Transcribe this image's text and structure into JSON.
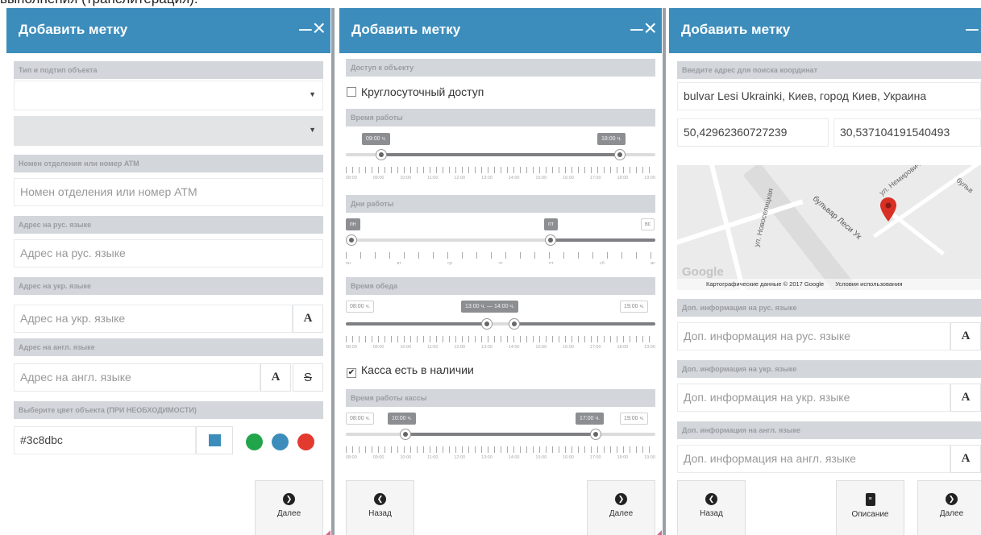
{
  "top_caption": "выполнения (транслитерация).",
  "panels": [
    {
      "title": "Добавить метку",
      "minimize_label": "–",
      "close_label": "×",
      "type_label": "Тип и подтип объекта",
      "type_select_value": "",
      "subtype_select_value": "",
      "branch_label": "Номен отделения или номер ATM",
      "branch_placeholder": "Номен отделения или номер ATM",
      "addr_ru_label": "Адрес на рус. языке",
      "addr_ru_placeholder": "Адрес на рус. языке",
      "addr_uk_label": "Адрес на укр. языке",
      "addr_uk_placeholder": "Адрес на укр. языке",
      "addr_en_label": "Адрес на англ. языке",
      "addr_en_placeholder": "Адрес на англ. языке",
      "translit_button": "A",
      "strike_button": "S",
      "color_label": "Выберите цвет объекта (ПРИ НЕОБХОДИМОСТИ)",
      "color_value": "#3c8dbc",
      "color_options": [
        "#22a54a",
        "#3c8dbc",
        "#e23a2f"
      ],
      "next_label": "Далее"
    },
    {
      "title": "Добавить метку",
      "minimize_label": "–",
      "close_label": "×",
      "access_label": "Доступ к объекту",
      "access_checkbox": "Круглосуточный доступ",
      "access_checked": false,
      "work_time_label": "Время работы",
      "work_start": "09:00 ч.",
      "work_end": "18:00 ч.",
      "work_start_fraction": 0.1,
      "work_end_fraction": 0.9,
      "hours_ticks": [
        "08:00",
        "09:00",
        "10:00",
        "11:00",
        "12:00",
        "13:00",
        "14:00",
        "15:00",
        "16:00",
        "17:00",
        "18:00",
        "19:00"
      ],
      "days_label": "Дни работы",
      "days_start": "пн",
      "days_end": "пт",
      "days_max": "вс",
      "days_ticks": [
        "пн",
        "вт",
        "ср",
        "чт",
        "пт",
        "сб",
        "вс"
      ],
      "days_start_fraction": 0.0,
      "days_end_fraction": 0.667,
      "lunch_label": "Время обеда",
      "lunch_min": "08:00 ч.",
      "lunch_range": "13:00 ч. — 14:00 ч.",
      "lunch_max": "19:00 ч.",
      "lunch_start_fraction": 0.455,
      "lunch_end_fraction": 0.545,
      "cashier_checkbox": "Касса есть в наличии",
      "cashier_checked": true,
      "cashier_time_label": "Время работы кассы",
      "cashier_min": "08:00 ч.",
      "cashier_start": "10:00 ч.",
      "cashier_end": "17:00 ч.",
      "cashier_max": "19:00 ч.",
      "cashier_start_fraction": 0.182,
      "cashier_end_fraction": 0.818,
      "back_label": "Назад",
      "next_label": "Далее"
    },
    {
      "title": "Добавить метку",
      "minimize_label": "–",
      "close_label": "×",
      "search_label": "Введите адрес для поиска координат",
      "address_value": "bulvar Lesi Ukrainki, Киев, город Киев, Украина",
      "lat_value": "50,42962360727239",
      "lng_value": "30,537104191540493",
      "map_streets": [
        "бульвар Леси Ук",
        "ул. Новоселицкая",
        "ул. Немировича",
        "бульв"
      ],
      "map_logo": "Google",
      "map_attribution": "Картографические данные © 2017 Google",
      "map_terms": "Условия использования",
      "info_ru_label": "Доп. информация на рус. языке",
      "info_ru_placeholder": "Доп. информация на рус. языке",
      "info_uk_label": "Доп. информация на укр. языке",
      "info_uk_placeholder": "Доп. информация на укр. языке",
      "info_en_label": "Доп. информация на англ. языке",
      "info_en_placeholder": "Доп. информация на англ. языке",
      "translit_button": "A",
      "back_label": "Назад",
      "description_label": "Описание",
      "next_label": "Далее"
    }
  ],
  "icons": {
    "close": "close-icon",
    "minimize": "minimize-icon",
    "next": "arrow-right-circle-icon",
    "back": "arrow-left-circle-icon",
    "description": "document-icon",
    "map_pin": "map-pin-icon"
  },
  "colors": {
    "accent": "#3c8dbc"
  }
}
